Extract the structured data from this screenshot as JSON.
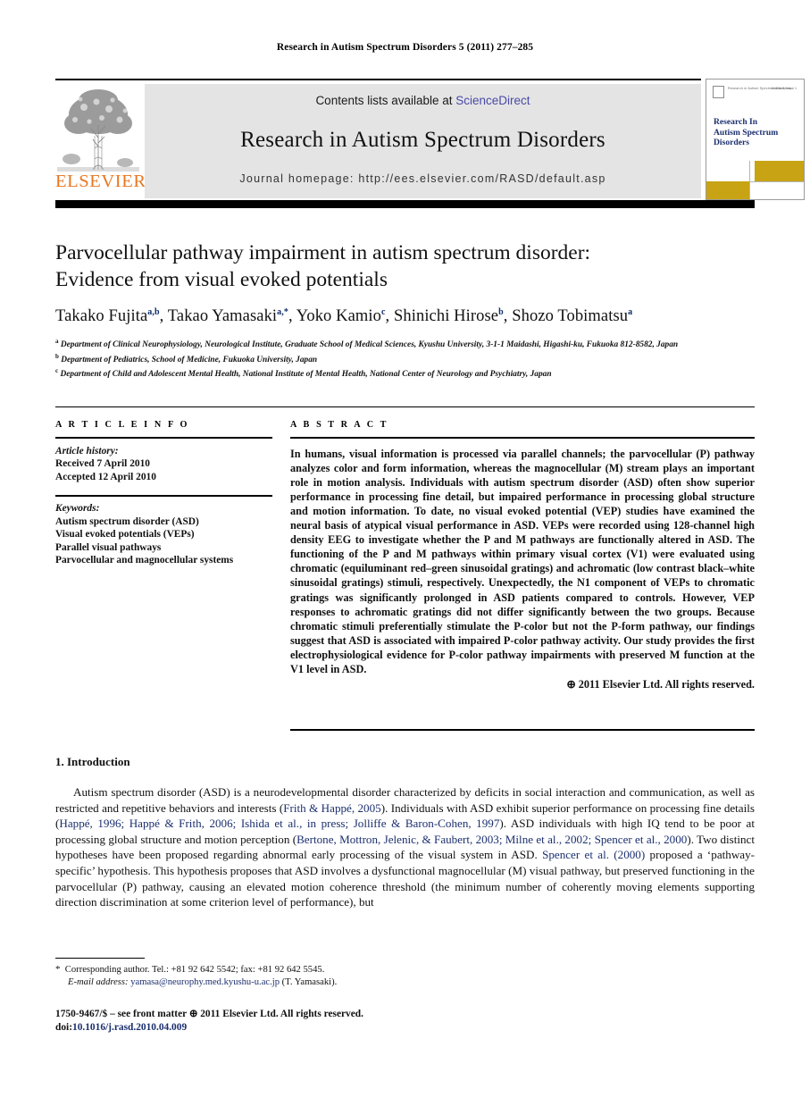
{
  "running_head": "Research in Autism Spectrum Disorders 5 (2011) 277–285",
  "journal_header": {
    "contents_prefix": "Contents lists available at ",
    "sciencedirect_label": "ScienceDirect",
    "journal_title": "Research in Autism Spectrum Disorders",
    "homepage": "Journal homepage: http://ees.elsevier.com/RASD/default.asp",
    "publisher_wordmark": "ELSEVIER",
    "cover": {
      "title_line1": "Research In",
      "title_line2": "Autism Spectrum",
      "title_line3": "Disorders",
      "mini_text": "Research in Autism Spectrum Disorders",
      "mini_right": "Volume 5, Issue 1",
      "accent_color": "#C8A415",
      "title_color": "#1b2f6e"
    },
    "link_color": "#4a49a8"
  },
  "article": {
    "title_line1": "Parvocellular pathway impairment in autism spectrum disorder:",
    "title_line2": "Evidence from visual evoked potentials",
    "authors": [
      {
        "name": "Takako Fujita",
        "sup": "a,b"
      },
      {
        "name": "Takao Yamasaki",
        "sup": "a,*"
      },
      {
        "name": "Yoko Kamio",
        "sup": "c"
      },
      {
        "name": "Shinichi Hirose",
        "sup": "b"
      },
      {
        "name": "Shozo Tobimatsu",
        "sup": "a"
      }
    ],
    "affiliations": [
      {
        "marker": "a",
        "text": "Department of Clinical Neurophysiology, Neurological Institute, Graduate School of Medical Sciences, Kyushu University, 3-1-1 Maidashi, Higashi-ku, Fukuoka 812-8582, Japan"
      },
      {
        "marker": "b",
        "text": "Department of Pediatrics, School of Medicine, Fukuoka University, Japan"
      },
      {
        "marker": "c",
        "text": "Department of Child and Adolescent Mental Health, National Institute of Mental Health, National Center of Neurology and Psychiatry, Japan"
      }
    ]
  },
  "article_info": {
    "heading": "A R T I C L E    I N F O",
    "history_label": "Article history:",
    "received": "Received 7 April 2010",
    "accepted": "Accepted 12 April 2010",
    "keywords_label": "Keywords:",
    "keywords": [
      "Autism spectrum disorder (ASD)",
      "Visual evoked potentials (VEPs)",
      "Parallel visual pathways",
      "Parvocellular and magnocellular systems"
    ]
  },
  "abstract": {
    "heading": "A B S T R A C T",
    "text": "In humans, visual information is processed via parallel channels; the parvocellular (P) pathway analyzes color and form information, whereas the magnocellular (M) stream plays an important role in motion analysis. Individuals with autism spectrum disorder (ASD) often show superior performance in processing fine detail, but impaired performance in processing global structure and motion information. To date, no visual evoked potential (VEP) studies have examined the neural basis of atypical visual performance in ASD. VEPs were recorded using 128-channel high density EEG to investigate whether the P and M pathways are functionally altered in ASD. The functioning of the P and M pathways within primary visual cortex (V1) were evaluated using chromatic (equiluminant red–green sinusoidal gratings) and achromatic (low contrast black–white sinusoidal gratings) stimuli, respectively. Unexpectedly, the N1 component of VEPs to chromatic gratings was significantly prolonged in ASD patients compared to controls. However, VEP responses to achromatic gratings did not differ significantly between the two groups. Because chromatic stimuli preferentially stimulate the P-color but not the P-form pathway, our findings suggest that ASD is associated with impaired P-color pathway activity. Our study provides the first electrophysiological evidence for P-color pathway impairments with preserved M function at the V1 level in ASD.",
    "copyright": "⊕ 2011 Elsevier Ltd. All rights reserved."
  },
  "body": {
    "section_heading": "1. Introduction",
    "paragraph_segments": [
      {
        "type": "text",
        "value": "Autism spectrum disorder (ASD) is a neurodevelopmental disorder characterized by deficits in social interaction and communication, as well as restricted and repetitive behaviors and interests ("
      },
      {
        "type": "cite",
        "value": "Frith & Happé, 2005"
      },
      {
        "type": "text",
        "value": "). Individuals with ASD exhibit superior performance on processing fine details ("
      },
      {
        "type": "cite",
        "value": "Happé, 1996; Happé & Frith, 2006; Ishida et al., in press; Jolliffe & Baron-Cohen, 1997"
      },
      {
        "type": "text",
        "value": "). ASD individuals with high IQ tend to be poor at processing global structure and motion perception ("
      },
      {
        "type": "cite",
        "value": "Bertone, Mottron, Jelenic, & Faubert, 2003; Milne et al., 2002; Spencer et al., 2000"
      },
      {
        "type": "text",
        "value": "). Two distinct hypotheses have been proposed regarding abnormal early processing of the visual system in ASD. "
      },
      {
        "type": "cite",
        "value": "Spencer et al. (2000)"
      },
      {
        "type": "text",
        "value": " proposed a ‘pathway-specific’ hypothesis. This hypothesis proposes that ASD involves a dysfunctional magnocellular (M) visual pathway, but preserved functioning in the parvocellular (P) pathway, causing an elevated motion coherence threshold (the minimum number of coherently moving elements supporting direction discrimination at some criterion level of performance), but"
      }
    ],
    "cite_color": "#1b2f6e"
  },
  "footnote": {
    "corresponding": "Corresponding author. Tel.: +81 92 642 5542; fax: +81 92 642 5545.",
    "email_label": "E-mail address:",
    "email": "yamasa@neurophy.med.kyushu-u.ac.jp",
    "email_suffix": "(T. Yamasaki)."
  },
  "footer": {
    "issn_line": "1750-9467/$ – see front matter ⊕ 2011 Elsevier Ltd. All rights reserved.",
    "doi_prefix": "doi:",
    "doi": "10.1016/j.rasd.2010.04.009"
  }
}
